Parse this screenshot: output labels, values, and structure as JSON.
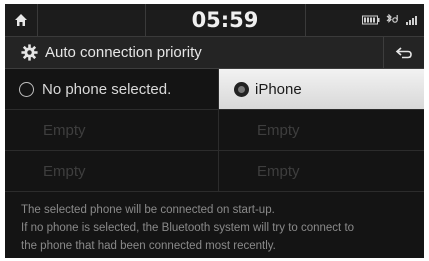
{
  "statusbar": {
    "time": "05:59",
    "icons": [
      "battery-icon",
      "bluetooth-audio-icon",
      "signal-icon"
    ]
  },
  "titlebar": {
    "title": "Auto connection priority",
    "gear_icon": "gear-icon",
    "back_icon": "back-arrow-icon"
  },
  "options": {
    "row1_left": "No phone selected.",
    "row1_right": "iPhone",
    "row2_left": "Empty",
    "row2_right": "Empty",
    "row3_left": "Empty",
    "row3_right": "Empty"
  },
  "info": {
    "line1": "The selected phone will be connected on start-up.",
    "line2": "If no phone is selected, the Bluetooth system will try to connect to",
    "line3": "the phone that had been connected most recently."
  },
  "colors": {
    "background": "#141414",
    "selected_cell": "#e6e6e6",
    "text": "#d9d9d9",
    "dim_text": "#3e3e3e"
  }
}
